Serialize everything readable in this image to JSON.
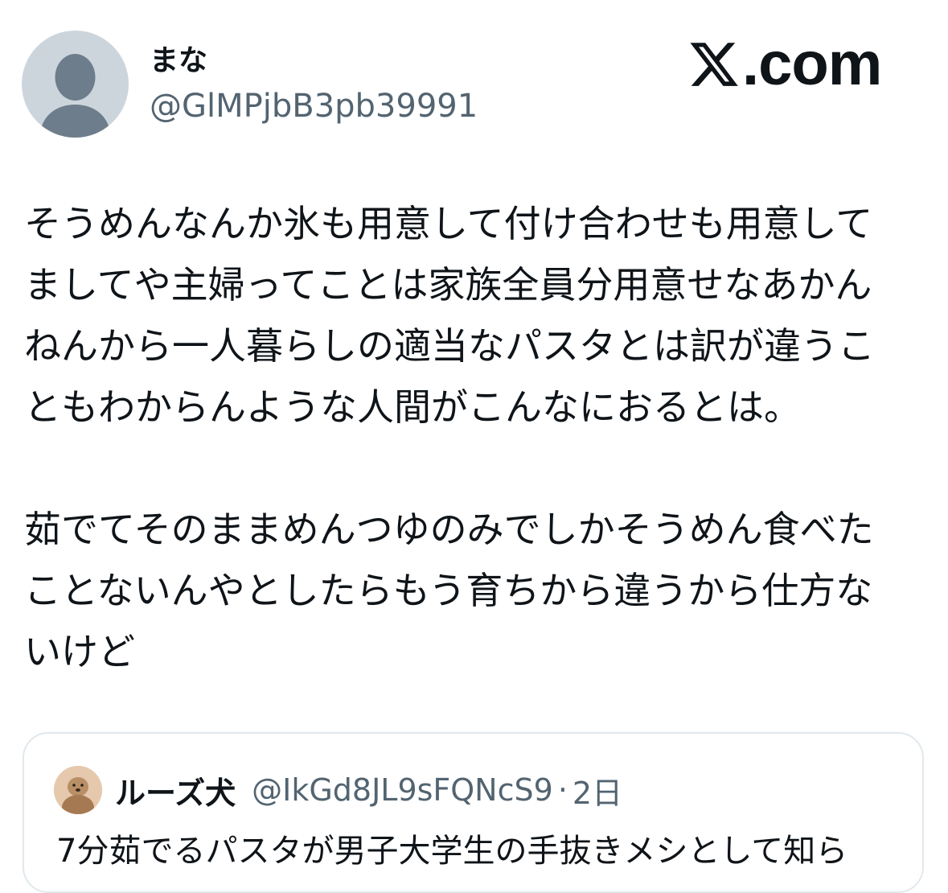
{
  "author": {
    "display_name": "まな",
    "handle": "@GlMPjbB3pb39991",
    "avatar_icon": "default-profile-icon"
  },
  "brand": {
    "logo_icon": "x-logo-icon",
    "text": ".com"
  },
  "tweet": {
    "paragraph_1": "そうめんなんか氷も用意して付け合わせも用意して\nましてや主婦ってことは家族全員分用意せなあかん\nねんから一人暮らしの適当なパスタとは訳が違うこ\nともわからんような人間がこんなにおるとは。",
    "paragraph_2": "茹でてそのままめんつゆのみでしかそうめん食べた\nことないんやとしたらもう育ちから違うから仕方な\nいけど"
  },
  "quoted_tweet": {
    "display_name": "ルーズ犬",
    "handle": "@IkGd8JL9sFQNcS9",
    "separator": "·",
    "time": "2日",
    "text": "7分茹でるパスタが男子大学生の手抜きメシとして知ら",
    "avatar_icon": "otter-avatar-icon"
  },
  "colors": {
    "text_primary": "#0f1419",
    "text_secondary": "#536471",
    "avatar_bg": "#cdd5dc",
    "avatar_figure": "#6d7d8b",
    "card_border": "#e1e8ed"
  }
}
